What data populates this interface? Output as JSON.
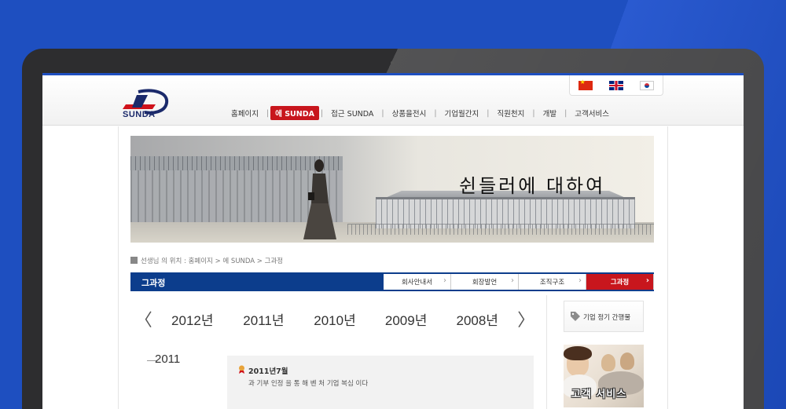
{
  "languages": [
    {
      "icon": "china-flag-icon"
    },
    {
      "icon": "uk-flag-icon"
    },
    {
      "icon": "korea-flag-icon"
    }
  ],
  "logo": {
    "text": "SUNDA",
    "icon": "sunda-logo-icon"
  },
  "nav": {
    "items": [
      {
        "label": "홈페이지"
      },
      {
        "label": "에 SUNDA",
        "active": true
      },
      {
        "label": "접근 SUNDA"
      },
      {
        "label": "상품을전시"
      },
      {
        "label": "기업월간지"
      },
      {
        "label": "직원천지"
      },
      {
        "label": "개발"
      },
      {
        "label": "고객서비스"
      }
    ]
  },
  "banner": {
    "title": "쉰들러에 대하여"
  },
  "breadcrumb": {
    "text": "선생님 의 위치 :   홈페이지 > 에 SUNDA > 그과정"
  },
  "subnav": {
    "title": "그과정",
    "tabs": [
      {
        "label": "회사안내서"
      },
      {
        "label": "회장발언"
      },
      {
        "label": "조직구조"
      },
      {
        "label": "그과정",
        "active": true
      }
    ]
  },
  "years": {
    "prev": "〈",
    "next": "〉",
    "items": [
      "2012년",
      "2011년",
      "2010년",
      "2009년",
      "2008년"
    ]
  },
  "timeline": {
    "year": "2011",
    "event": {
      "date": "2011년7월",
      "description": "과 기부 인정 을 통 해 벤 처 기업 복심 이다",
      "icon": "award-icon"
    }
  },
  "sidebar": {
    "card1": {
      "label": "기업 정기 간행물",
      "icon": "tag-icon"
    },
    "card2": {
      "label": "고객 서비스"
    }
  },
  "colors": {
    "accent_red": "#c8161d",
    "navy": "#0c3d8c",
    "background_blue": "#1e4fc0"
  }
}
